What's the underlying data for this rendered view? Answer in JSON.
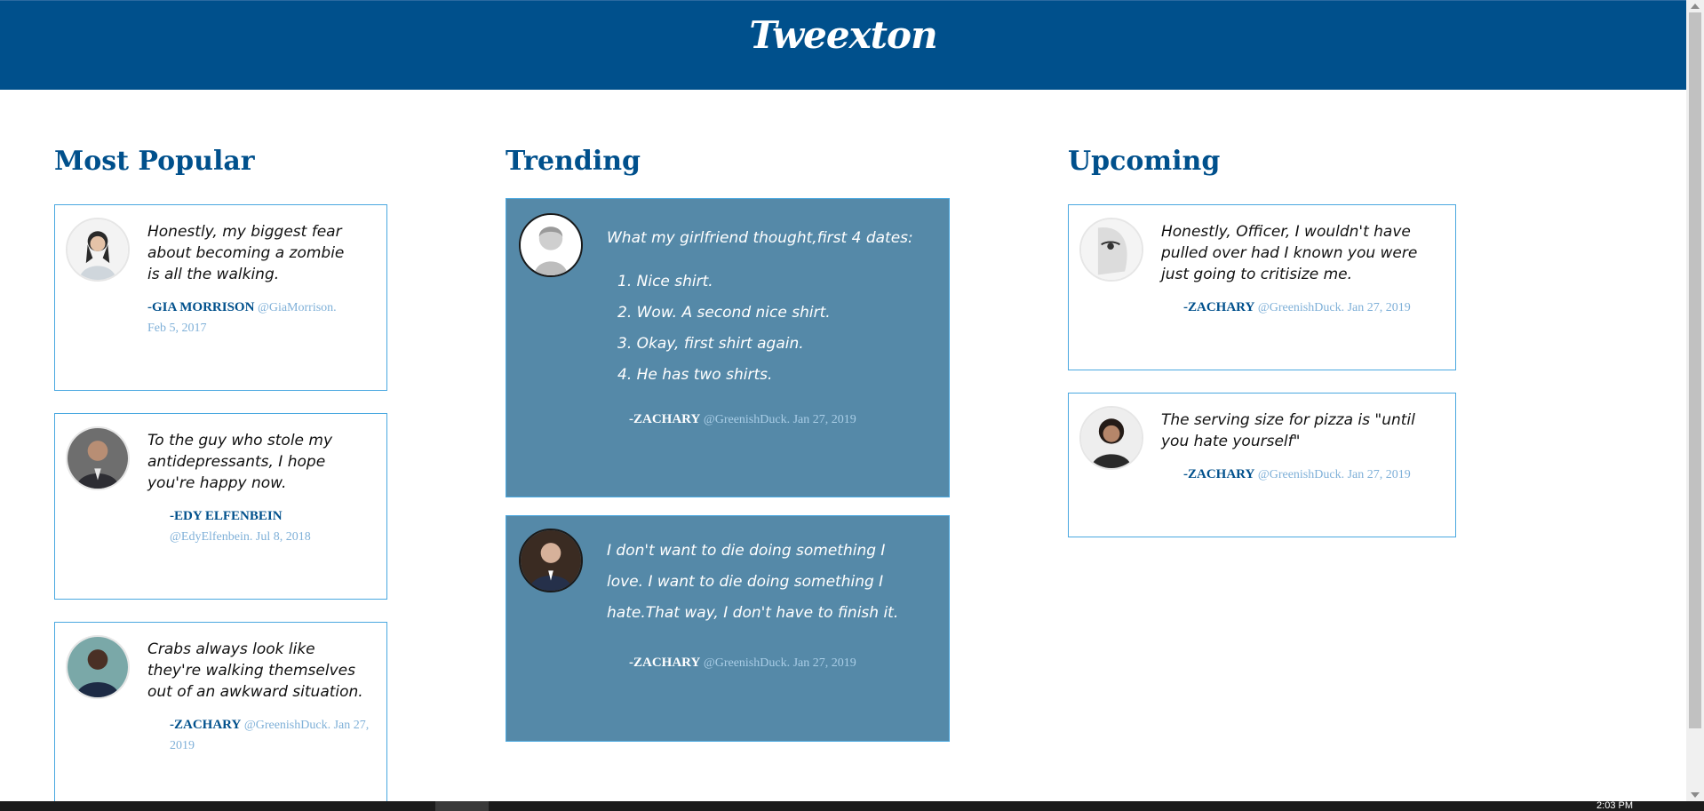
{
  "app": {
    "brand": "Tweexton"
  },
  "columns": {
    "popular": {
      "title": "Most Popular",
      "tweets": [
        {
          "text": "Honestly, my biggest fear about becoming a zombie is all the walking.",
          "author": "-GIA MORRISON",
          "handle": "@GiaMorrison.",
          "date": "Feb 5, 2017"
        },
        {
          "text": "To the guy who stole my antidepressants, I hope you're happy now.",
          "author": "-EDY ELFENBEIN",
          "handle": "@EdyElfenbein.",
          "date": "Jul 8, 2018"
        },
        {
          "text": "Crabs always look like they're walking themselves out of an awkward situation.",
          "author": "-ZACHARY",
          "handle": "@GreenishDuck.",
          "date": "Jan 27, 2019"
        }
      ]
    },
    "trending": {
      "title": "Trending",
      "tweets": [
        {
          "text": "What my girlfriend thought,first 4 dates:",
          "list": [
            "1. Nice shirt.",
            "2. Wow. A second nice shirt.",
            "3. Okay, first shirt again.",
            "4. He has two shirts."
          ],
          "author": "-ZACHARY",
          "handle": "@GreenishDuck.",
          "date": "Jan 27, 2019"
        },
        {
          "text": "I don't want to die doing something I love. I want to die doing something I hate.That way, I don't have to finish it.",
          "author": "-ZACHARY",
          "handle": "@GreenishDuck.",
          "date": "Jan 27, 2019"
        }
      ]
    },
    "upcoming": {
      "title": "Upcoming",
      "tweets": [
        {
          "text": "Honestly, Officer, I wouldn't have pulled over had I known you were just going to critisize me.",
          "author": "-ZACHARY",
          "handle": "@GreenishDuck.",
          "date": "Jan 27, 2019"
        },
        {
          "text": "The serving size for pizza is \"until you hate yourself\"",
          "author": "-ZACHARY",
          "handle": "@GreenishDuck.",
          "date": "Jan 27, 2019"
        }
      ]
    }
  },
  "taskbar": {
    "clock": "2:03 PM"
  },
  "colors": {
    "header": "#00508c",
    "trending_card": "#5589a8",
    "card_border": "#4aa8e0"
  },
  "icons": [
    "avatar-icon"
  ]
}
